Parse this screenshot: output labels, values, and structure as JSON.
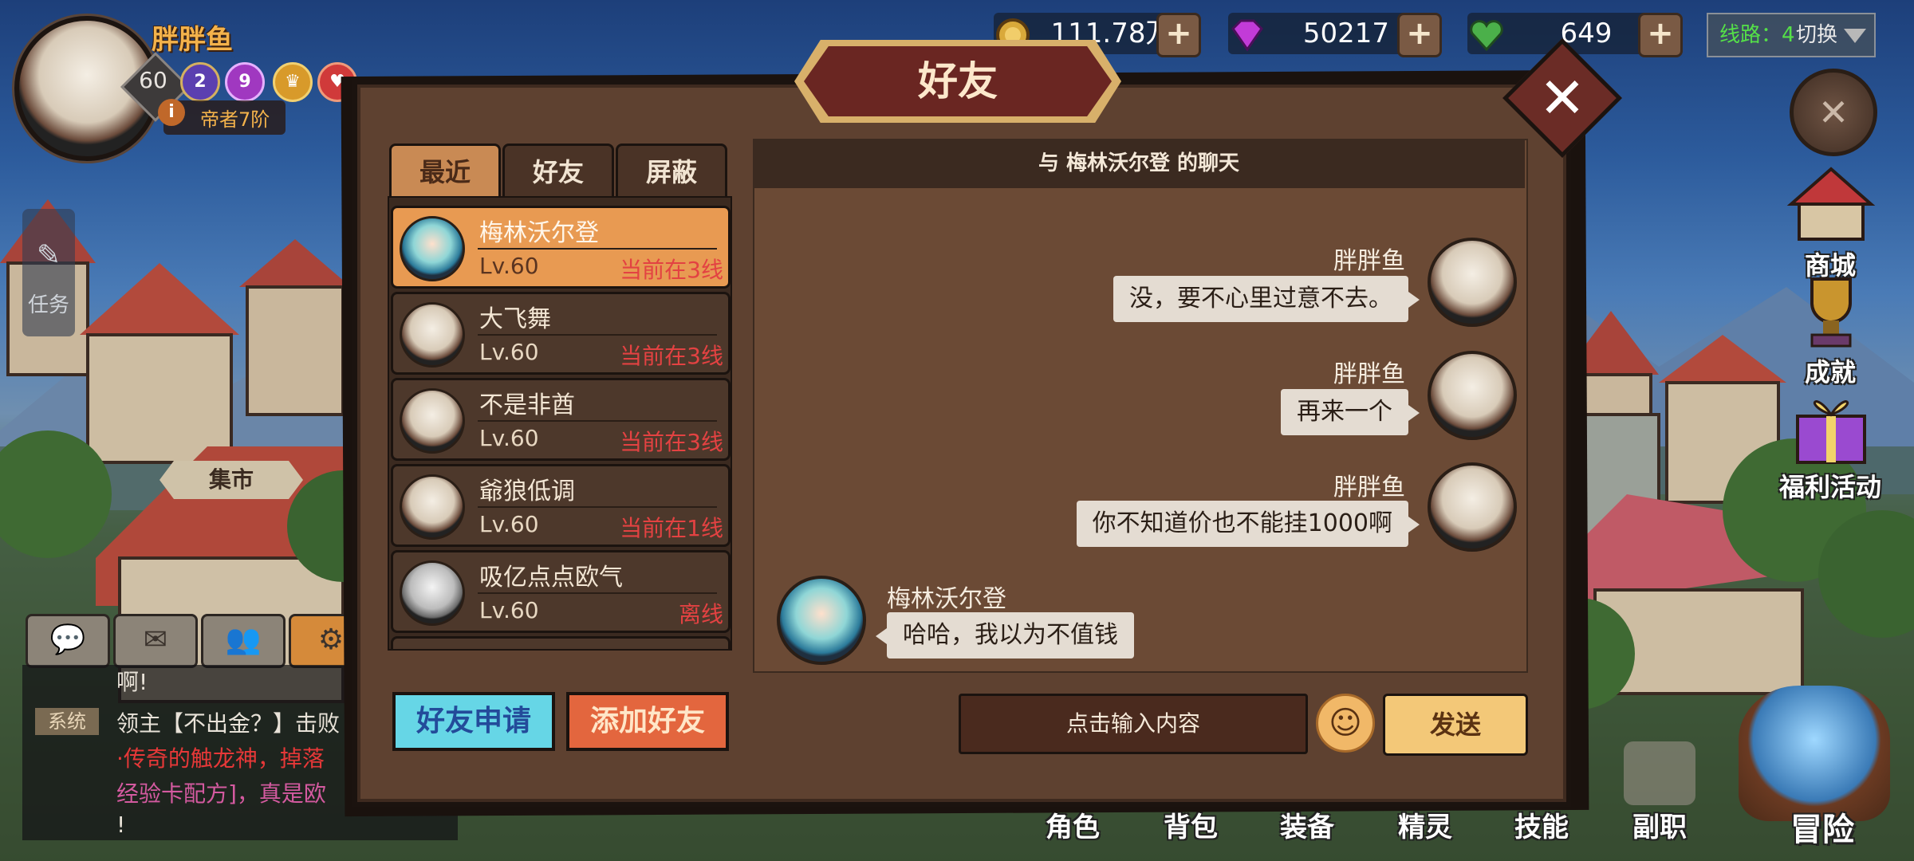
{
  "player": {
    "name": "胖胖鱼",
    "level": "60",
    "rank": "帝者7阶",
    "badges": [
      "2",
      "9"
    ]
  },
  "resources": {
    "gold": "111.78万",
    "gems": "50217",
    "stamina": "649"
  },
  "server_line": {
    "label": "线路：4",
    "switch": "切换"
  },
  "side_menu": [
    "商城",
    "成就",
    "福利活动"
  ],
  "left": {
    "task": "任务",
    "market": "集市"
  },
  "chat_log": {
    "line0": "啊!",
    "system_tag": "系统",
    "line1": "领主【不出金？】击败",
    "line2": "·传奇的触龙神，掉落",
    "line3": "经验卡配方]，真是欧",
    "line4": "!"
  },
  "bottom_nav": [
    "角色",
    "背包",
    "装备",
    "精灵",
    "技能",
    "副职",
    "冒险"
  ],
  "dialog": {
    "title": "好友",
    "tabs": [
      "最近",
      "好友",
      "屏蔽"
    ],
    "friends": [
      {
        "name": "梅林沃尔登",
        "level": "Lv.60",
        "status": "当前在3线"
      },
      {
        "name": "大飞舞",
        "level": "Lv.60",
        "status": "当前在3线"
      },
      {
        "name": "不是非酋",
        "level": "Lv.60",
        "status": "当前在3线"
      },
      {
        "name": "爺狼低调",
        "level": "Lv.60",
        "status": "当前在1线"
      },
      {
        "name": "吸亿点点欧气",
        "level": "Lv.60",
        "status": "离线"
      }
    ],
    "apply_button": "好友申请",
    "add_button": "添加好友",
    "chat_title": "与 梅林沃尔登 的聊天",
    "messages": [
      {
        "sender": "胖胖鱼",
        "text": "没，要不心里过意不去。"
      },
      {
        "sender": "胖胖鱼",
        "text": "再来一个"
      },
      {
        "sender": "胖胖鱼",
        "text": "你不知道价也不能挂1000啊"
      },
      {
        "sender": "梅林沃尔登",
        "text": "哈哈，我以为不值钱"
      }
    ],
    "input_placeholder": "点击输入内容",
    "send_button": "发送"
  },
  "colors": {
    "dialog_bg": "#5e4130",
    "selected_row": "#e89a52",
    "status_red": "#e34242",
    "apply_cyan": "#66d6e6",
    "add_orange": "#e3663e",
    "send_gold": "#f3c878"
  }
}
